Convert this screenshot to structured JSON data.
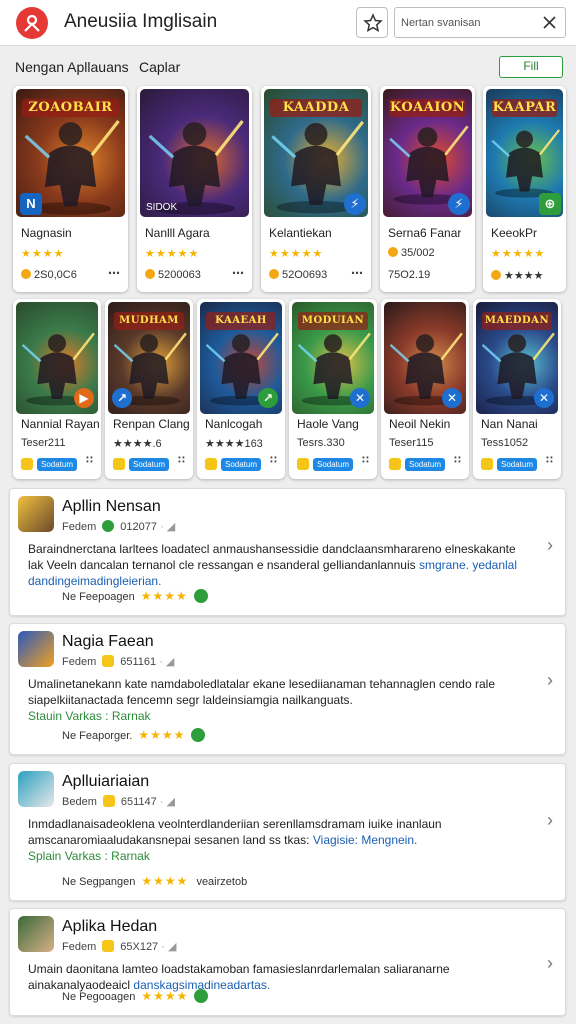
{
  "app": {
    "title": "Aneusiia Imglisain"
  },
  "search": {
    "placeholder": "Nertan svanisan"
  },
  "section": {
    "label": "Nengan Apllauans",
    "sub": "Caplar",
    "filter_label": "Fill"
  },
  "row1": [
    {
      "thumb_title": "ZOAOBAIR",
      "name": "Nagnasin",
      "stars": "★★★★",
      "meta": "2S0,0C6",
      "badge": "N",
      "colors": [
        "#8a3a1c",
        "#e0842a",
        "#3b1a12"
      ]
    },
    {
      "thumb_title": "",
      "name": "Nanlll Agara",
      "stars": "★★★★★",
      "meta": "5200063",
      "tag": "SIDOK",
      "colors": [
        "#4a2a7a",
        "#e06a2a",
        "#2a1a3a"
      ]
    },
    {
      "thumb_title": "KAADDA",
      "name": "Kelantiekan",
      "stars": "★★★★★",
      "meta": "52O0693",
      "badge": "⚡",
      "colors": [
        "#2f6a8a",
        "#e8b030",
        "#2a4a2a"
      ]
    },
    {
      "thumb_title": "KOAAION",
      "name": "Sernа6 Fanar",
      "stars": "★★★★",
      "meta": "35/002",
      "meta2": "75O2.19",
      "badge": "⚡",
      "colors": [
        "#6a2a8a",
        "#e04a2a",
        "#3a1a1a"
      ]
    },
    {
      "thumb_title": "KAAPAR",
      "name": "KeeokPr",
      "stars": "★★★★★",
      "meta": "★★★★",
      "badge": "⊕",
      "colors": [
        "#1e7ab0",
        "#6ac04a",
        "#1a3a5a"
      ]
    }
  ],
  "row2": [
    {
      "thumb_title": "",
      "name": "Nannial Rayan",
      "meta": "Teser211",
      "chip": "Sodatum",
      "badge": "▶",
      "colors": [
        "#3a7a4a",
        "#e07a2a",
        "#2a4a2a"
      ]
    },
    {
      "thumb_title": "MUDHAM",
      "name": "Renpan Clang",
      "meta": "★★★★.6",
      "chip": "Sodatum",
      "badge": "↗",
      "colors": [
        "#5a3a2a",
        "#e0a03a",
        "#2a1a1a"
      ]
    },
    {
      "thumb_title": "KAAEAH",
      "name": "Nanlcogah",
      "meta": "★★★★163",
      "chip": "Sodatum",
      "badge": "↗",
      "colors": [
        "#1e5a9a",
        "#c04a3a",
        "#1a2a4a"
      ]
    },
    {
      "thumb_title": "MODUIAN",
      "name": "Haole Vang",
      "meta": "Tesrs.330",
      "chip": "Sodatum",
      "badge": "✕",
      "colors": [
        "#3a9a4a",
        "#e0c04a",
        "#2a5a2a"
      ]
    },
    {
      "thumb_title": "",
      "name": "Neoil Nekin",
      "meta": "Teser115",
      "chip": "Sodatum",
      "badge": "✕",
      "colors": [
        "#8a3a2a",
        "#d08a4a",
        "#2a1a1a"
      ]
    },
    {
      "thumb_title": "MAEDDAN",
      "name": "Nan Nanai",
      "meta": "Tess1052",
      "chip": "Sodatum",
      "badge": "✕",
      "colors": [
        "#2a4a8a",
        "#5ac0d0",
        "#1a1a3a"
      ]
    }
  ],
  "reviews": [
    {
      "title": "Apllin Nensan",
      "sub_prefix": "Fedem",
      "sub_date": "012077",
      "body": "Baraindnerctana larltees loadatecl anmaushansessidie dandclaansmharareno elneskakante lak Veeln dancalan ternanol cle ressangan e nsanderal gelliandanlannuis",
      "body_link": "smgrane. yedanlal dandingeimadingleierian.",
      "foot": "Ne Feepoagen",
      "stars": "★★★★",
      "icon_colors": [
        "#f0c040",
        "#6a4a2a"
      ]
    },
    {
      "title": "Nagia Faean",
      "sub_prefix": "Fedem",
      "sub_date": "651161",
      "body": "Umalinetanekann kate namdaboledlatalar ekane lesediianaman tehannaglen cendo rale siapelkiitanactada fencemn segr laldeinsiamgia nailkanguats.",
      "body_green": "Stauin Varkas : Rarnak",
      "foot": "Ne Feaporger.",
      "stars": "★★★★",
      "icon_colors": [
        "#2a5ac0",
        "#f0a020"
      ]
    },
    {
      "title": "Aplluiariaian",
      "sub_prefix": "Bedem",
      "sub_date": "651147",
      "body": "Inmdadlanaisadeoklena veolnterdlanderiian serenllamsdramam iuike inanlaun amscanaromiaaludakansnepai sesanen land ss tkas:",
      "body_link": "Viagisie: Mengnein.",
      "body_green": "Splain Varkas : Rarnak",
      "foot": "Ne Segpangen",
      "stars": "★★★★",
      "foot_extra": "veairzetob",
      "icon_colors": [
        "#2aa0c0",
        "#e8e8e8"
      ]
    },
    {
      "title": "Aplika Hedan",
      "sub_prefix": "Fedem",
      "sub_date": "65X127",
      "body": "Umain daonitana lamteo loadstakamoban famasieslanrdarlemalan saliaranarne ainakanalyaodeaicl",
      "body_link": "danskagsimadineadartas.",
      "foot": "Ne Pegooagen",
      "stars": "★★★★",
      "icon_colors": [
        "#3a6a3a",
        "#d8b088"
      ]
    }
  ]
}
